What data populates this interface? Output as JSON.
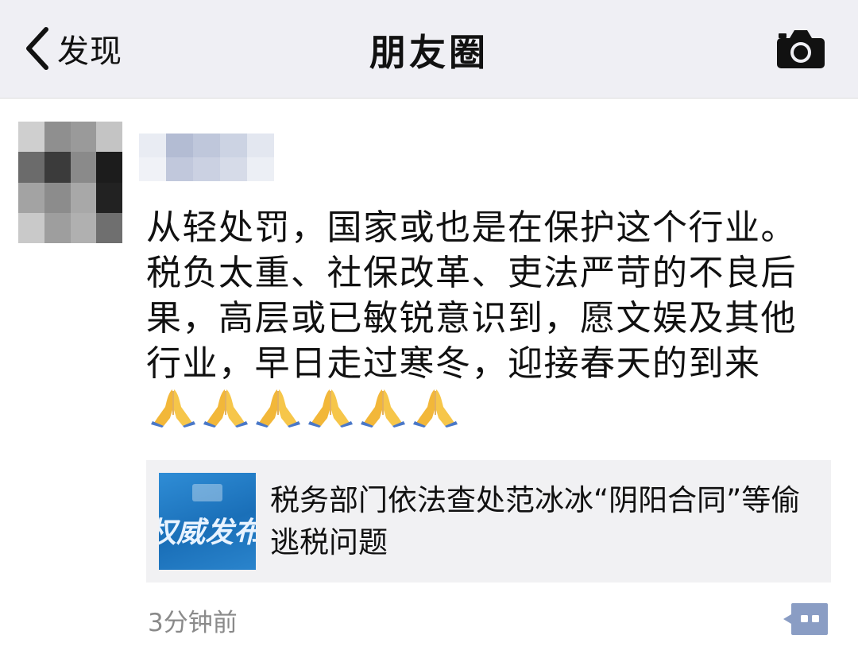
{
  "navbar": {
    "back_label": "发现",
    "title": "朋友圈",
    "camera_icon": "camera-icon"
  },
  "post": {
    "text": "从轻处罚，国家或也是在保护这个行业。税负太重、社保改革、吏法严苛的不良后果，高层或已敏锐意识到，愿文娱及其他行业，早日走过寒冬，迎接春天的到来",
    "emoji": "prayer-hands-icon",
    "emoji_count": 6,
    "link": {
      "title": "税务部门依法查处范冰冰“阴阳合同”等偷逃税问题",
      "thumbnail_text": "权威发布"
    },
    "timestamp": "3分钟前",
    "comment_icon": "comment-bubble-icon"
  },
  "colors": {
    "navbar_bg": "#efeff4",
    "link_card_bg": "#f1f1f3",
    "timestamp": "#8a8a8a",
    "comment_icon": "#8a9dc4"
  }
}
